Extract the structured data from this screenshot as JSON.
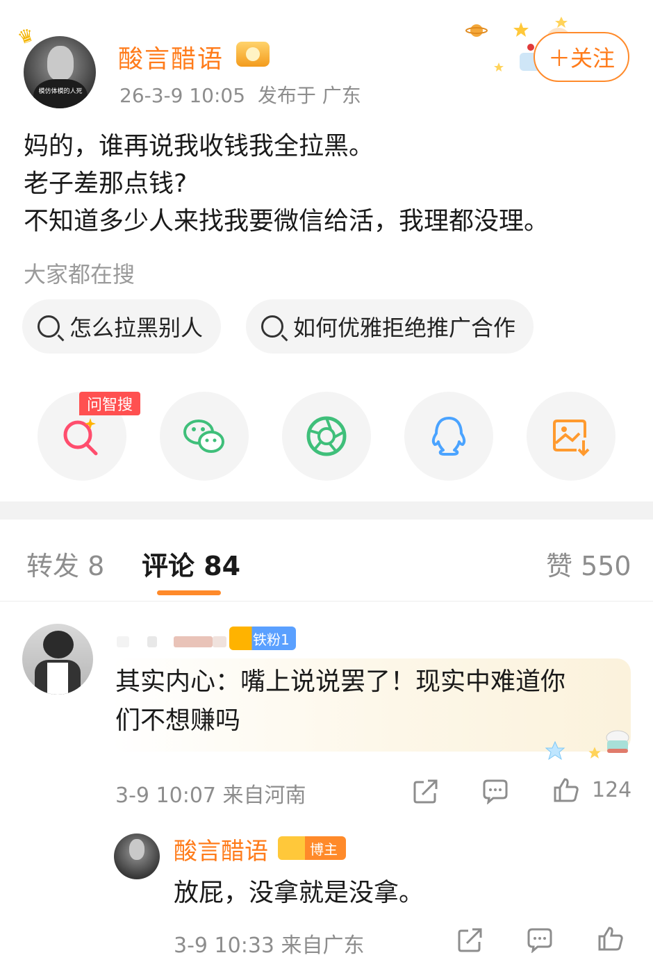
{
  "post": {
    "author_name": "酸言醋语",
    "avatar_caption": "模仿体模的人死",
    "timestamp": "26-3-9 10:05",
    "location": "发布于 广东",
    "follow_label": "＋关注",
    "text_lines": [
      "妈的，谁再说我收钱我全拉黑。",
      "老子差那点钱?",
      "不知道多少人来找我要微信给活，我理都没理。"
    ]
  },
  "search": {
    "title": "大家都在搜",
    "chips": [
      "怎么拉黑别人",
      "如何优雅拒绝推广合作"
    ]
  },
  "share": {
    "wenzhisou_tag": "问智搜",
    "icons": [
      "wenzhisou-search-icon",
      "wechat-icon",
      "moments-icon",
      "qq-icon",
      "save-image-icon"
    ]
  },
  "tabs": {
    "repost": "转发 8",
    "comments": "评论 84",
    "likes": "赞 550"
  },
  "comment": {
    "fan_badge": "铁粉1",
    "text_line1": "其实内心：嘴上说说罢了！现实中难道你",
    "text_line2": "们不想赚吗",
    "time": "3-9 10:07",
    "location": "来自河南",
    "like_count": "124"
  },
  "reply": {
    "author_name": "酸言醋语",
    "host_badge": "博主",
    "text": "放屁，没拿就是没拿。",
    "time": "3-9 10:33",
    "location": "来自广东"
  },
  "colors": {
    "accent": "#ff7b1a",
    "wechat": "#3fbf7a",
    "qq": "#4aa3ff",
    "save": "#ff9a2e",
    "wenzhisou": "#ff4d6d"
  }
}
